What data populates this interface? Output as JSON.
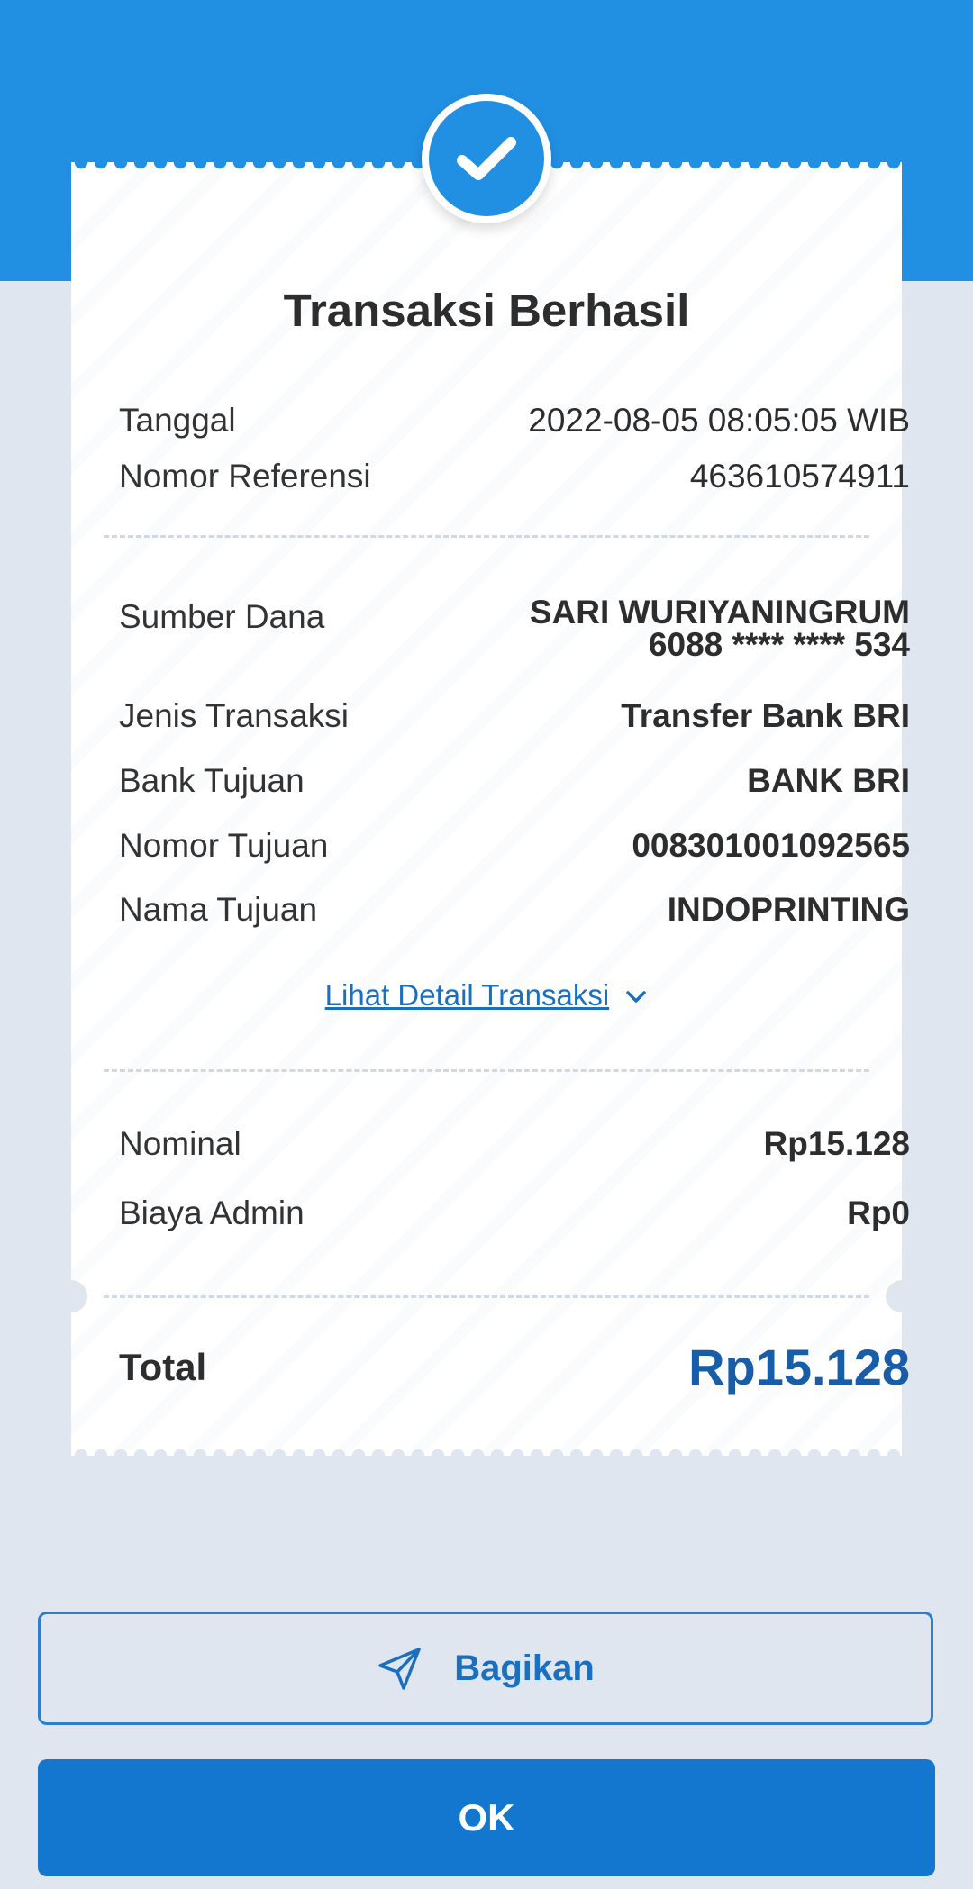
{
  "receipt": {
    "title": "Transaksi Berhasil",
    "tanggal_label": "Tanggal",
    "tanggal_value": "2022-08-05 08:05:05 WIB",
    "referensi_label": "Nomor Referensi",
    "referensi_value": "463610574911",
    "sumber_label": "Sumber Dana",
    "sumber_name": "SARI WURIYANINGRUM",
    "sumber_account": "6088 **** **** 534",
    "jenis_label": "Jenis Transaksi",
    "jenis_value": "Transfer Bank BRI",
    "bank_label": "Bank Tujuan",
    "bank_value": "BANK BRI",
    "nomor_tujuan_label": "Nomor Tujuan",
    "nomor_tujuan_value": "008301001092565",
    "nama_tujuan_label": "Nama Tujuan",
    "nama_tujuan_value": "INDOPRINTING",
    "detail_link": "Lihat Detail Transaksi",
    "nominal_label": "Nominal",
    "nominal_value": "Rp15.128",
    "admin_label": "Biaya Admin",
    "admin_value": "Rp0",
    "total_label": "Total",
    "total_value": "Rp15.128"
  },
  "actions": {
    "share_label": "Bagikan",
    "ok_label": "OK"
  },
  "colors": {
    "primary": "#2190e3",
    "button": "#1377cf",
    "total": "#175da8",
    "background": "#dfe6ef"
  },
  "icons": {
    "status": "check-icon",
    "share": "send-icon",
    "expand": "chevron-down-icon"
  }
}
